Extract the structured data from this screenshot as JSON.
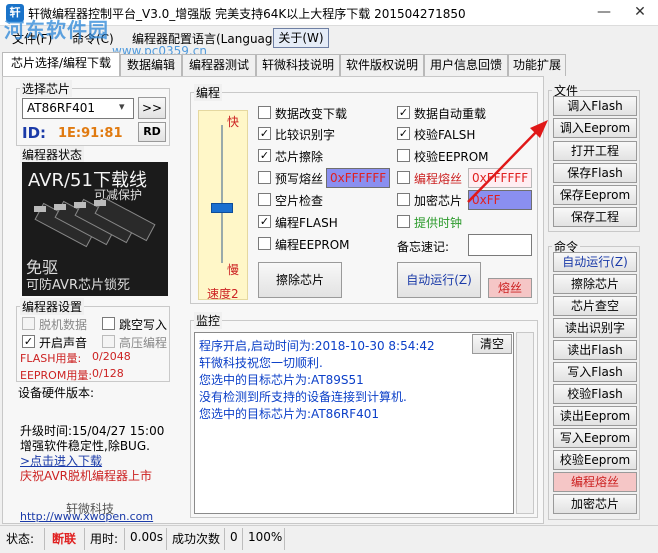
{
  "window": {
    "title": "轩微编程器控制平台_V3.0_增强版 完美支持64K以上大程序下载 201504271850",
    "minimize": "—",
    "close": "✕"
  },
  "watermark": {
    "site": "河东软件园",
    "url": "www.pc0359.cn"
  },
  "menu": {
    "file": "文件(F)",
    "command": "命令(C)",
    "lang": "编程器配置语言(Language)",
    "about": "关于(W)"
  },
  "tabs": [
    "芯片选择/编程下载",
    "数据编辑",
    "编程器测试",
    "轩微科技说明",
    "软件版权说明",
    "用户信息回馈",
    "功能扩展"
  ],
  "chip": {
    "group": "选择芯片",
    "selected": "AT86RF401",
    "next_btn": ">>",
    "id_label": "ID:",
    "id_value": "1E:91:81",
    "rd_btn": "RD"
  },
  "status_panel": {
    "group": "编程器状态",
    "overlay_top": "AVR/51下载线",
    "overlay_mid": "可减保护",
    "overlay_free": "免驱",
    "overlay_bottom": "可防AVR芯片锁死"
  },
  "settings": {
    "group": "编程器设置",
    "options": [
      {
        "label": "脱机数据",
        "checked": false,
        "enabled": false
      },
      {
        "label": "跳空写入",
        "checked": false,
        "enabled": true
      },
      {
        "label": "开启声音",
        "checked": true,
        "enabled": true
      },
      {
        "label": "高压编程",
        "checked": false,
        "enabled": false
      }
    ],
    "flash_label": "FLASH用量:",
    "flash_value": "0/2048",
    "eeprom_label": "EEPROM用量:",
    "eeprom_value": "0/128"
  },
  "hw": {
    "version_label": "设备硬件版本:",
    "upgrade": "升级时间:15/04/27 15:00",
    "note": "增强软件稳定性,除BUG.",
    "link": ">点击进入下载",
    "celebrate": "庆祝AVR脱机编程器上市",
    "company": "轩微科技",
    "url": "http://www.xwopen.com"
  },
  "program": {
    "group": "编程",
    "slider": {
      "fast": "快",
      "slow": "慢",
      "speed": "速度2",
      "level": 0.5
    },
    "left": [
      {
        "label": "数据改变下载",
        "checked": false
      },
      {
        "label": "比较识别字",
        "checked": true
      },
      {
        "label": "芯片擦除",
        "checked": true
      },
      {
        "label": "预写熔丝",
        "checked": false,
        "value": "0xFFFFFF"
      },
      {
        "label": "空片检查",
        "checked": false
      },
      {
        "label": "编程FLASH",
        "checked": true
      },
      {
        "label": "编程EEPROM",
        "checked": false
      }
    ],
    "right": [
      {
        "label": "数据自动重载",
        "checked": true
      },
      {
        "label": "校验FALSH",
        "checked": true
      },
      {
        "label": "校验EEPROM",
        "checked": false
      },
      {
        "label": "编程熔丝",
        "checked": false,
        "value": "0xFFFFFF"
      },
      {
        "label": "加密芯片",
        "checked": false,
        "value": "0xFF"
      },
      {
        "label": "提供时钟",
        "checked": false
      }
    ],
    "memo_label": "备忘速记:",
    "memo_value": "",
    "erase_btn": "擦除芯片",
    "auto_btn": "自动运行(Z)",
    "fuse_btn": "熔丝"
  },
  "monitor": {
    "group": "监控",
    "clear_btn": "清空",
    "lines": [
      "程序开启,启动时间为:2018-10-30 8:54:42",
      "轩微科技祝您一切顺利.",
      "您选中的目标芯片为:AT89S51",
      "没有检测到所支持的设备连接到计算机.",
      "您选中的目标芯片为:AT86RF401"
    ]
  },
  "file_group": {
    "group": "文件",
    "buttons": [
      "调入Flash",
      "调入Eeprom",
      "打开工程",
      "保存Flash",
      "保存Eeprom",
      "保存工程"
    ]
  },
  "cmd_group": {
    "group": "命令",
    "buttons": [
      "自动运行(Z)",
      "擦除芯片",
      "芯片查空",
      "读出识别字",
      "读出Flash",
      "写入Flash",
      "校验Flash",
      "读出Eeprom",
      "写入Eeprom",
      "校验Eeprom",
      "编程熔丝",
      "加密芯片"
    ]
  },
  "statusbar": {
    "state_label": "状态:",
    "state_value": "断联",
    "time_label": "用时:",
    "time_value": "0.00s",
    "success_label": "成功次数",
    "success_value": "0",
    "percent": "100%"
  },
  "colors": {
    "accent_blue": "#1a3aa8",
    "alert_red": "#e02020",
    "arrow_red": "#e01818"
  }
}
